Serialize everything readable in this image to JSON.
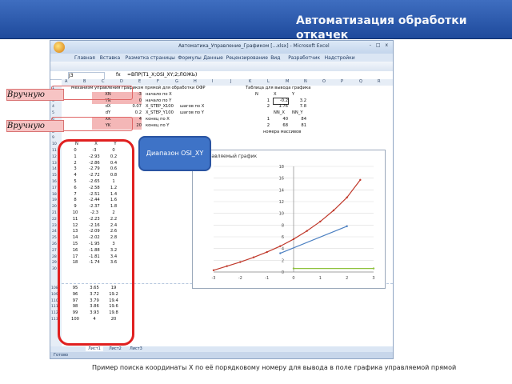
{
  "slide": {
    "title": "Автоматизация обработки откачек",
    "manual_label": "Вручную",
    "range_callout": "Диапазон OSI_XY",
    "caption": "Пример поиска координаты Х по её порядковому номеру для вывода в поле графика управляемой прямой"
  },
  "excel": {
    "window_title": "Автоматика_Управление_Графиком [...xlsx] - Microsoft Excel",
    "window_controls": "- □ x",
    "ribbon_tabs": [
      "Главная",
      "Вставка",
      "Разметка страницы",
      "Формулы",
      "Данные",
      "Рецензирование",
      "Вид",
      "Разработчик",
      "Надстройки"
    ],
    "name_box": "J3",
    "fx_symbol": "fx",
    "formula": "=ВПР(T1_X;OSI_XY;2;ЛОЖЬ)",
    "sheet_tabs": [
      "Лист1",
      "Лист2",
      "Лист3"
    ],
    "status": "Готово",
    "columns": [
      "A",
      "B",
      "C",
      "D",
      "E",
      "F",
      "G",
      "H",
      "I",
      "J",
      "K",
      "L",
      "M",
      "N",
      "O",
      "P",
      "Q",
      "R"
    ],
    "header_left": "Механизм управления графиком прямой для обработки ОФР",
    "header_right": "Таблица для вывода графика",
    "params": [
      {
        "name": "XN",
        "value": "-3",
        "desc": "начало по X"
      },
      {
        "name": "YN",
        "value": "0",
        "desc": "начало по Y"
      },
      {
        "name": "dX",
        "value": "0.07",
        "desc": "X_STEP_X",
        "n": "100",
        "unit": "шагов по X"
      },
      {
        "name": "dY",
        "value": "0.2",
        "desc": "X_STEP_Y",
        "n": "100",
        "unit": "шагов по Y"
      },
      {
        "name": "XK",
        "value": "4",
        "desc": "конец по X"
      },
      {
        "name": "YK",
        "value": "20",
        "desc": "конец по Y"
      }
    ],
    "right_table": {
      "headers1": [
        "N",
        "X",
        "Y"
      ],
      "rows1": [
        [
          "1",
          "-0.2",
          "3.2"
        ],
        [
          "2",
          "1.76",
          "7.8"
        ]
      ],
      "headers2": [
        "NN_X",
        "NN_Y"
      ],
      "rows2": [
        [
          "1",
          "40",
          "84"
        ],
        [
          "2",
          "68",
          "81"
        ]
      ],
      "note": "номера массивов"
    },
    "table_headers": [
      "N",
      "X",
      "Y"
    ],
    "table_rows": [
      [
        "0",
        "-3",
        "0"
      ],
      [
        "1",
        "-2.93",
        "0.2"
      ],
      [
        "2",
        "-2.86",
        "0.4"
      ],
      [
        "3",
        "-2.79",
        "0.6"
      ],
      [
        "4",
        "-2.72",
        "0.8"
      ],
      [
        "5",
        "-2.65",
        "1"
      ],
      [
        "6",
        "-2.58",
        "1.2"
      ],
      [
        "7",
        "-2.51",
        "1.4"
      ],
      [
        "8",
        "-2.44",
        "1.6"
      ],
      [
        "9",
        "-2.37",
        "1.8"
      ],
      [
        "10",
        "-2.3",
        "2"
      ],
      [
        "11",
        "-2.23",
        "2.2"
      ],
      [
        "12",
        "-2.16",
        "2.4"
      ],
      [
        "13",
        "-2.09",
        "2.6"
      ],
      [
        "14",
        "-2.02",
        "2.8"
      ],
      [
        "15",
        "-1.95",
        "3"
      ],
      [
        "16",
        "-1.88",
        "3.2"
      ],
      [
        "17",
        "-1.81",
        "3.4"
      ],
      [
        "18",
        "-1.74",
        "3.6"
      ]
    ],
    "table_rows_tail": [
      [
        "95",
        "3.65",
        "19"
      ],
      [
        "96",
        "3.72",
        "19.2"
      ],
      [
        "97",
        "3.79",
        "19.4"
      ],
      [
        "98",
        "3.86",
        "19.6"
      ],
      [
        "99",
        "3.93",
        "19.8"
      ],
      [
        "100",
        "4",
        "20"
      ]
    ],
    "row_numbers_top": [
      "1",
      "2",
      "3",
      "4",
      "5",
      "6",
      "7",
      "8",
      "9",
      "10",
      "11",
      "12",
      "13",
      "14",
      "15",
      "16",
      "17",
      "18",
      "19",
      "20",
      "21",
      "22",
      "23",
      "24",
      "25",
      "26",
      "27",
      "28",
      "29",
      "30"
    ],
    "row_numbers_tail": [
      "108",
      "109",
      "110",
      "111",
      "112",
      "113"
    ]
  },
  "chart_data": {
    "type": "line",
    "title": "Управляемый график",
    "xlim": [
      -3,
      3
    ],
    "ylim": [
      0,
      18
    ],
    "x_ticks": [
      "-3",
      "-2",
      "-1",
      "0",
      "1",
      "2",
      "3"
    ],
    "y_ticks": [
      "0",
      "2",
      "4",
      "6",
      "8",
      "10",
      "12",
      "14",
      "16",
      "18"
    ],
    "series": [
      {
        "color": "#c0392b",
        "x": [
          -3,
          -2.5,
          -2,
          -1.5,
          -1,
          -0.5,
          0,
          0.5,
          1,
          1.5,
          2,
          2.5
        ],
        "y": [
          0.3,
          1.0,
          1.7,
          2.5,
          3.4,
          4.4,
          5.6,
          7.0,
          8.6,
          10.5,
          12.7,
          15.7
        ]
      },
      {
        "color": "#4a7fc1",
        "x": [
          -0.5,
          2
        ],
        "y": [
          3.2,
          7.8
        ]
      },
      {
        "color": "#8fc23e",
        "x": [
          0,
          3
        ],
        "y": [
          0.6,
          0.6
        ]
      }
    ]
  }
}
